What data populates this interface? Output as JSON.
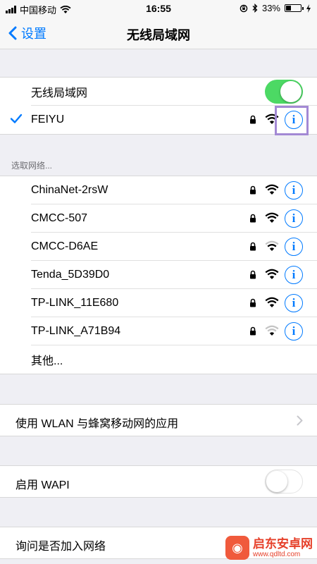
{
  "status_bar": {
    "carrier": "中国移动",
    "time": "16:55",
    "battery": "33%",
    "battery_level": 0.33
  },
  "nav": {
    "back_label": "设置",
    "title": "无线局域网"
  },
  "wlan_group": {
    "toggle_label": "无线局域网",
    "toggle_on": true,
    "connected_network": "FEIYU"
  },
  "networks_header": "选取网络...",
  "networks": [
    {
      "name": "ChinaNet-2rsW",
      "locked": true,
      "signal": 3
    },
    {
      "name": "CMCC-507",
      "locked": true,
      "signal": 3
    },
    {
      "name": "CMCC-D6AE",
      "locked": true,
      "signal": 2
    },
    {
      "name": "Tenda_5D39D0",
      "locked": true,
      "signal": 3
    },
    {
      "name": "TP-LINK_11E680",
      "locked": true,
      "signal": 3
    },
    {
      "name": "TP-LINK_A71B94",
      "locked": true,
      "signal": 2
    }
  ],
  "other_label": "其他...",
  "wlan_apps_label": "使用 WLAN 与蜂窝移动网的应用",
  "wapi": {
    "label": "启用 WAPI",
    "on": false
  },
  "ask_join_label": "询问是否加入网络",
  "watermark": {
    "name": "启东安卓网",
    "url": "www.qdltd.com"
  },
  "colors": {
    "accent": "#007aff",
    "toggle_on": "#4cd964",
    "highlight": "#a389d4"
  }
}
